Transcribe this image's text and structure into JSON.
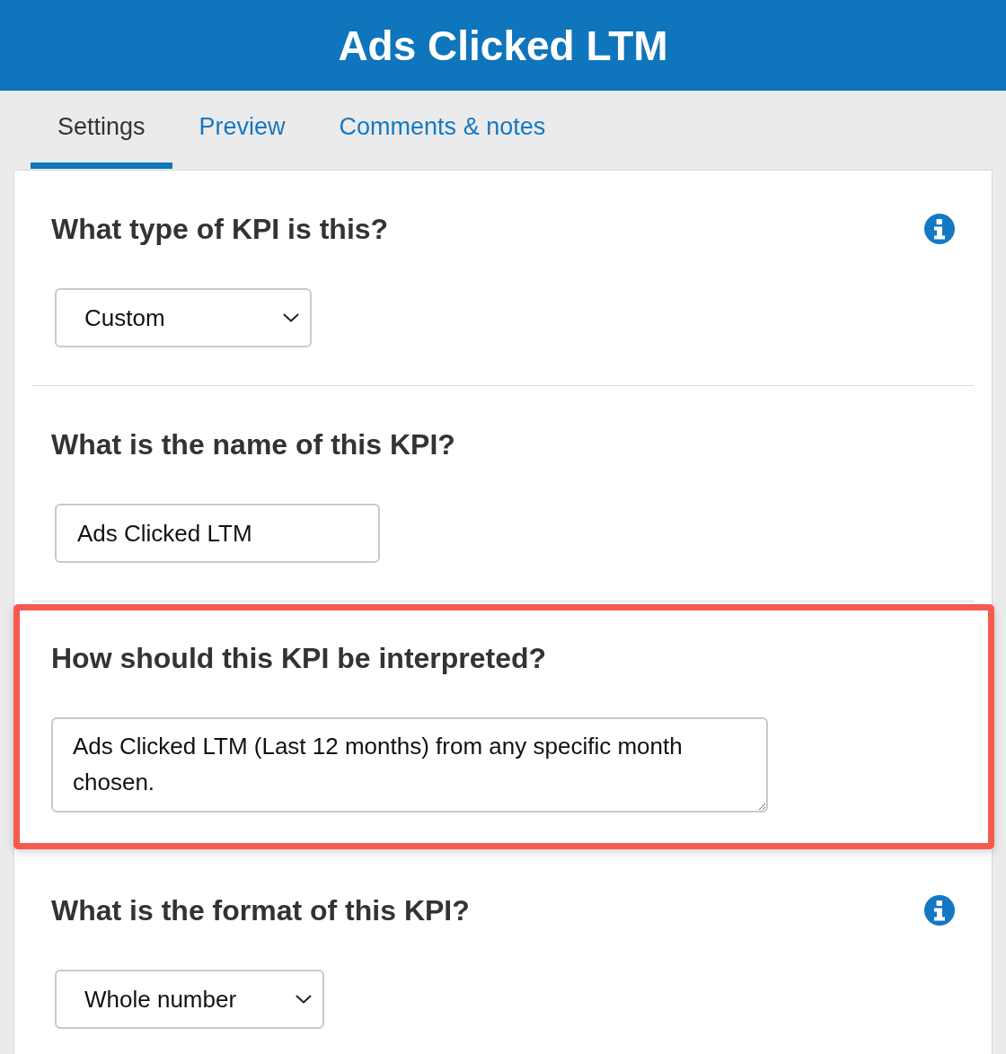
{
  "header": {
    "title": "Ads Clicked LTM"
  },
  "tabs": [
    {
      "label": "Settings",
      "selected": true
    },
    {
      "label": "Preview",
      "selected": false
    },
    {
      "label": "Comments & notes",
      "selected": false
    }
  ],
  "sections": [
    {
      "kind": "select",
      "question": "What type of KPI is this?",
      "info": true,
      "value": "Custom",
      "highlighted": false
    },
    {
      "kind": "input",
      "question": "What is the name of this KPI?",
      "info": false,
      "value": "Ads Clicked LTM",
      "highlighted": false
    },
    {
      "kind": "textarea",
      "question": "How should this KPI be interpreted?",
      "info": false,
      "value": "Ads Clicked LTM (Last 12 months) from any specific month chosen.",
      "highlighted": true
    },
    {
      "kind": "select",
      "question": "What is the format of this KPI?",
      "info": true,
      "value": "Whole number",
      "highlighted": false
    }
  ]
}
